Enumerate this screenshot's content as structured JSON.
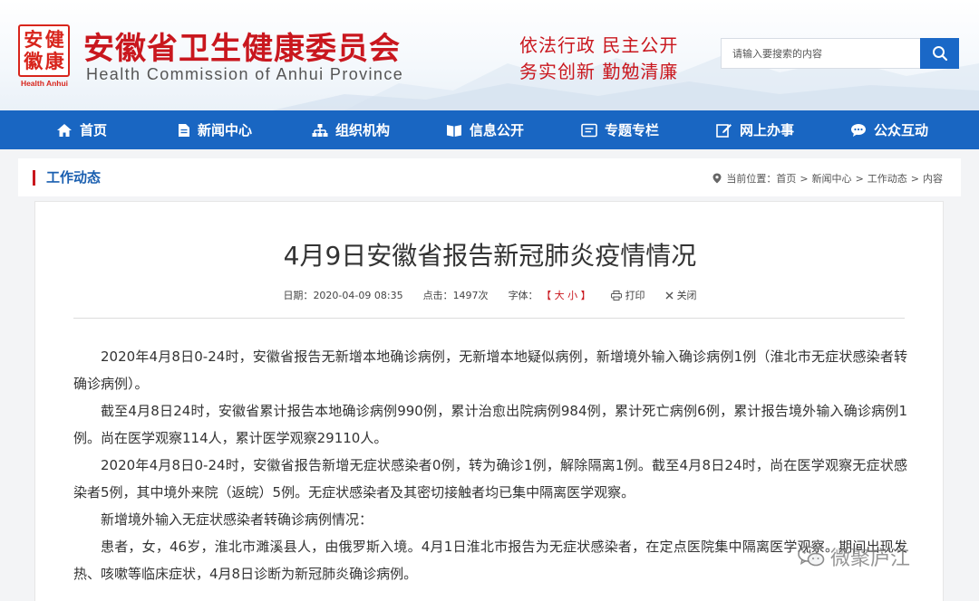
{
  "header": {
    "seal_chars": [
      "安",
      "健",
      "徽",
      "康"
    ],
    "seal_sub": "Health Anhui",
    "site_name_cn": "安徽省卫生健康委员会",
    "site_name_en": "Health Commission of Anhui Province",
    "slogan_line1": "依法行政  民主公开",
    "slogan_line2": "务实创新  勤勉清廉",
    "search": {
      "placeholder": "请输入要搜索的内容"
    },
    "brand_color": "#c9171e"
  },
  "nav": {
    "color": "#1966c2",
    "items": [
      {
        "label": "首页",
        "icon": "home-icon"
      },
      {
        "label": "新闻中心",
        "icon": "document-icon"
      },
      {
        "label": "组织机构",
        "icon": "org-chart-icon"
      },
      {
        "label": "信息公开",
        "icon": "book-icon"
      },
      {
        "label": "专题专栏",
        "icon": "topic-icon"
      },
      {
        "label": "网上办事",
        "icon": "edit-icon"
      },
      {
        "label": "公众互动",
        "icon": "chat-icon"
      }
    ]
  },
  "section": {
    "title": "工作动态"
  },
  "breadcrumb": {
    "prefix": "当前位置：",
    "items": [
      "首页",
      "新闻中心",
      "工作动态",
      "内容"
    ],
    "separator": ">"
  },
  "article": {
    "title": "4月9日安徽省报告新冠肺炎疫情情况",
    "date_label": "日期：",
    "date": "2020-04-09 08:35",
    "clicks_label": "点击：",
    "clicks": "1497次",
    "font_label": "字体：",
    "font_open": "【",
    "font_large": "大",
    "font_small": "小",
    "font_close": "】",
    "print_label": "打印",
    "close_label": "关闭",
    "paragraphs": [
      "2020年4月8日0-24时，安徽省报告无新增本地确诊病例，无新增本地疑似病例，新增境外输入确诊病例1例（淮北市无症状感染者转确诊病例）。",
      "截至4月8日24时，安徽省累计报告本地确诊病例990例，累计治愈出院病例984例，累计死亡病例6例，累计报告境外输入确诊病例1例。尚在医学观察114人，累计医学观察29110人。",
      "2020年4月8日0-24时，安徽省报告新增无症状感染者0例，转为确诊1例，解除隔离1例。截至4月8日24时，尚在医学观察无症状感染者5例，其中境外来院（返皖）5例。无症状感染者及其密切接触者均已集中隔离医学观察。",
      "新增境外输入无症状感染者转确诊病例情况：",
      "患者，女，46岁，淮北市濉溪县人，由俄罗斯入境。4月1日淮北市报告为无症状感染者，在定点医院集中隔离医学观察。期间出现发热、咳嗽等临床症状，4月8日诊断为新冠肺炎确诊病例。"
    ]
  },
  "watermark": {
    "text": "微聚庐江"
  }
}
